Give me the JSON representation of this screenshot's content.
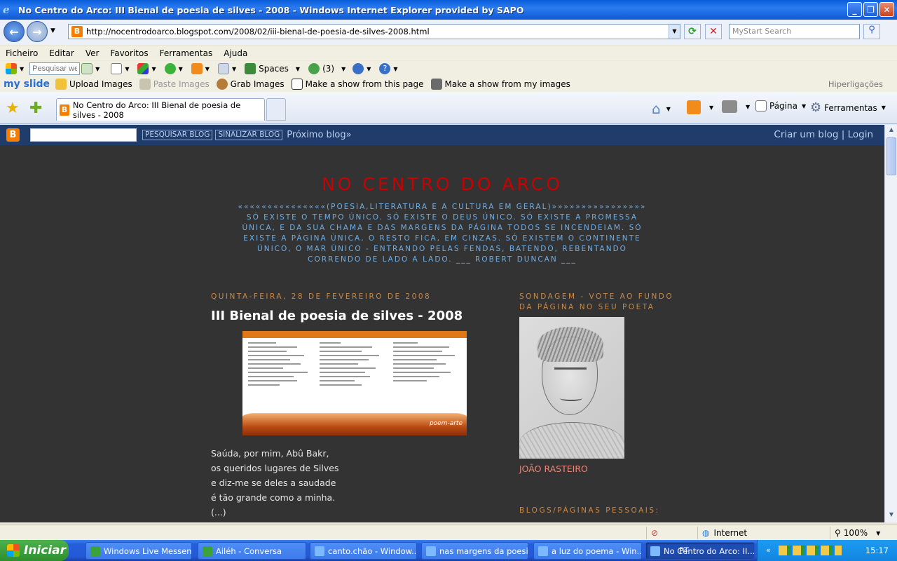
{
  "window": {
    "title": "No Centro do Arco: III Bienal de poesia de silves - 2008 - Windows Internet Explorer provided by SAPO",
    "min": "_",
    "max": "❐",
    "close": "✕"
  },
  "address": {
    "url": "http://nocentrodoarco.blogspot.com/2008/02/iii-bienal-de-poesia-de-silves-2008.html",
    "search_placeholder": "MyStart Search"
  },
  "menu": [
    "Ficheiro",
    "Editar",
    "Ver",
    "Favoritos",
    "Ferramentas",
    "Ajuda"
  ],
  "toolbar1": {
    "search_placeholder": "Pesquisar web",
    "spaces": "Spaces",
    "contacts": "(3)"
  },
  "toolbar2": {
    "brand": "my slide",
    "upload": "Upload Images",
    "paste": "Paste Images",
    "grab": "Grab Images",
    "show_page": "Make a show from this page",
    "show_mine": "Make a show from my images",
    "links": "Hiperligações"
  },
  "tab": {
    "title": "No Centro do Arco: III Bienal de poesia de silves - 2008"
  },
  "commands": {
    "page": "Página",
    "tools": "Ferramentas"
  },
  "navbar": {
    "search_btn": "PESQUISAR BLOG",
    "flag_btn": "SINALIZAR BLOG",
    "next": "Próximo blog»",
    "create": "Criar um blog",
    "sep": "|",
    "login": "Login"
  },
  "blog": {
    "title": "NO CENTRO DO ARCO",
    "description": "«««««««««««««««(POESIA,LITERATURA E A CULTURA EM GERAL)»»»»»»»»»»»»»»»» SÓ EXISTE O TEMPO ÚNICO. SÓ EXISTE O DEUS ÚNICO. SÓ EXISTE A PROMESSA ÚNICA, E DA SUA CHAMA E DAS MARGENS DA PÁGINA TODOS SE INCENDEIAM. SÓ EXISTE A PÁGINA ÚNICA, O RESTO FICA, EM CINZAS. SÓ EXISTEM O CONTINENTE ÚNICO, O MAR ÚNICO - ENTRANDO PELAS FENDAS, BATENDO, REBENTANDO CORRENDO DE LADO A LADO. ___ ROBERT DUNCAN ___"
  },
  "post": {
    "date": "QUINTA-FEIRA, 28 DE FEVEREIRO DE 2008",
    "title": "III Bienal de poesia de silves - 2008",
    "poster_caption": "poem-arte",
    "poem": [
      "Saúda, por mim, Abû Bakr,",
      "os queridos lugares de Silves",
      "e diz-me se deles a saudade",
      "é tão grande como a minha.",
      "(...)"
    ]
  },
  "sidebar": {
    "poll_header": "SONDAGEM - VOTE AO FUNDO DA PÁGINA NO SEU POETA",
    "poet_name": "JOÃO RASTEIRO",
    "blogs_header": "BLOGS/PÁGINAS PESSOAIS:"
  },
  "statusbar": {
    "zone": "Internet",
    "zoom": "100%"
  },
  "taskbar": {
    "start": "Iniciar",
    "tasks": [
      "Windows Live Messen...",
      "Ailéh - Conversa",
      "canto.chão - Window...",
      "nas margens da poesi...",
      "a luz do poema - Win...",
      "No Centro do Arco: II..."
    ],
    "lang": "PT",
    "time": "15:17"
  }
}
